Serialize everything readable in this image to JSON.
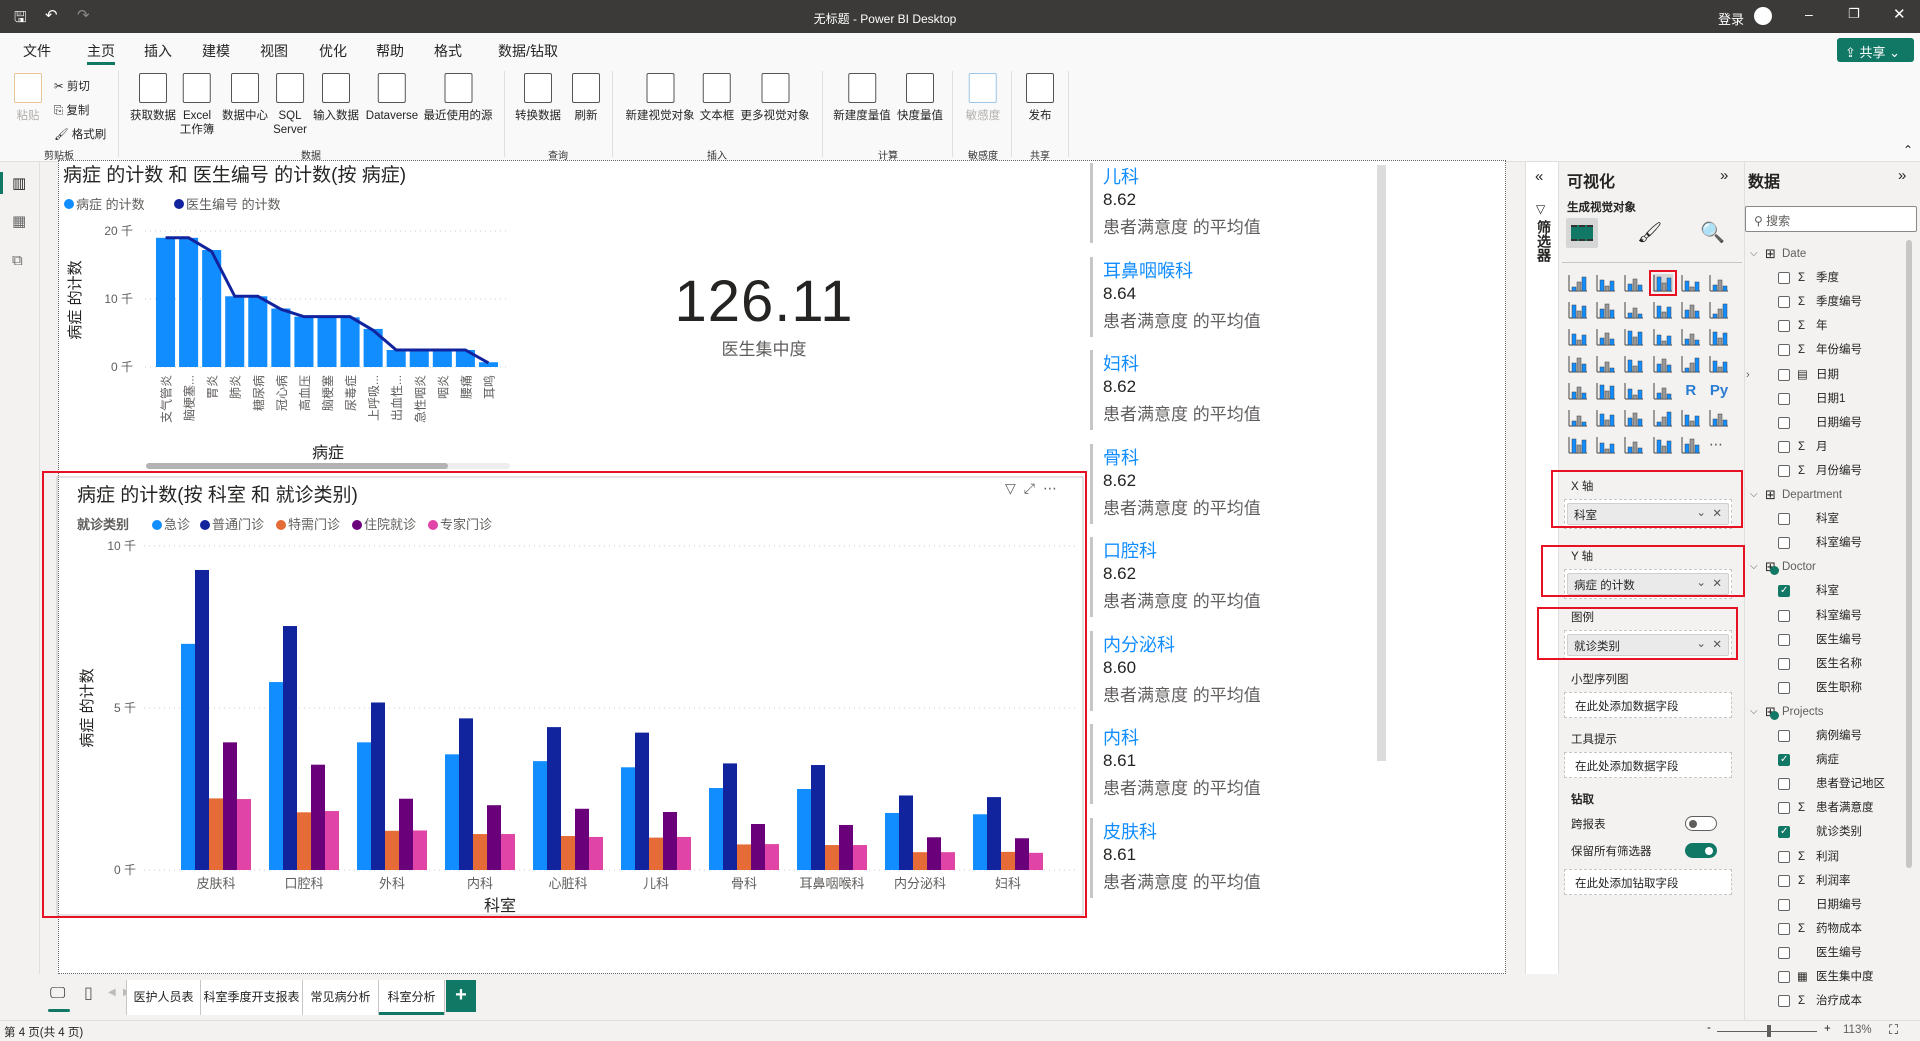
{
  "window": {
    "title": "无标题 - Power BI Desktop",
    "signin": "登录",
    "share_label": "共享"
  },
  "menu": {
    "items": [
      "文件",
      "主页",
      "插入",
      "建模",
      "视图",
      "优化",
      "帮助",
      "格式",
      "数据/钻取"
    ],
    "active": "主页"
  },
  "ribbon": {
    "clipboard": {
      "paste": "粘贴",
      "cut": "剪切",
      "copy": "复制",
      "format_painter": "格式刷"
    },
    "buttons": [
      "获取数据",
      "Excel\n工作簿",
      "数据中心",
      "SQL\nServer",
      "输入数据",
      "Dataverse",
      "最近使用的源",
      "转换数据",
      "刷新",
      "新建视觉对象",
      "文本框",
      "更多视觉对象",
      "新建度量值",
      "快度量值",
      "敏感度",
      "发布"
    ],
    "groups": [
      "剪贴板",
      "数据",
      "查询",
      "插入",
      "计算",
      "敏感度",
      "共享"
    ]
  },
  "colors": {
    "accent": "#117865",
    "series1": "#118DFF",
    "series2": "#12239E",
    "series3": "#E66C37",
    "series4": "#6B007B",
    "series5": "#E044A7",
    "highlight": "#E81123"
  },
  "chart_data": [
    {
      "type": "bar+line",
      "title": "病症 的计数 和 医生编号 的计数(按 病症)",
      "xlabel": "病症",
      "ylabel": "病症 的计数",
      "ylim": [
        0,
        20000
      ],
      "yticks": [
        "0 千",
        "10 千",
        "20 千"
      ],
      "grid": true,
      "legend": "top-left",
      "categories": [
        "支气管炎",
        "脑梗塞...",
        "胃炎",
        "肺炎",
        "糖尿病",
        "冠心病",
        "高血压",
        "脑梗塞",
        "尿毒症",
        "上呼吸...",
        "出血性...",
        "急性咽炎",
        "咽炎",
        "腰痛",
        "耳鸣"
      ],
      "series": [
        {
          "name": "病症 的计数",
          "kind": "bar",
          "values": [
            19000,
            19000,
            17200,
            10400,
            10400,
            8600,
            7400,
            7400,
            7300,
            5600,
            2500,
            2500,
            2500,
            2500,
            700
          ]
        },
        {
          "name": "医生编号 的计数",
          "kind": "line",
          "values": [
            19000,
            19000,
            17000,
            10400,
            10400,
            8500,
            7400,
            7400,
            7400,
            5400,
            2500,
            2500,
            2500,
            2500,
            600
          ]
        }
      ]
    },
    {
      "type": "bar",
      "title": "病症 的计数(按 科室 和 就诊类别)",
      "xlabel": "科室",
      "ylabel": "病症 的计数",
      "legend_title": "就诊类别",
      "ylim": [
        0,
        10000
      ],
      "yticks": [
        "0 千",
        "5 千",
        "10 千"
      ],
      "grid": true,
      "legend": "top-left",
      "categories": [
        "皮肤科",
        "口腔科",
        "外科",
        "内科",
        "心脏科",
        "儿科",
        "骨科",
        "耳鼻咽喉科",
        "内分泌科",
        "妇科"
      ],
      "series": [
        {
          "name": "急诊",
          "values": [
            6980,
            5800,
            3940,
            3570,
            3360,
            3170,
            2530,
            2500,
            1760,
            1720
          ]
        },
        {
          "name": "普通门诊",
          "values": [
            9260,
            7530,
            5170,
            4680,
            4410,
            4240,
            3290,
            3240,
            2300,
            2250
          ]
        },
        {
          "name": "特需门诊",
          "values": [
            2210,
            1780,
            1210,
            1110,
            1050,
            1000,
            790,
            770,
            550,
            560
          ]
        },
        {
          "name": "住院就诊",
          "values": [
            3940,
            3250,
            2200,
            2000,
            1890,
            1790,
            1420,
            1390,
            1010,
            980
          ]
        },
        {
          "name": "专家门诊",
          "values": [
            2190,
            1820,
            1220,
            1110,
            1020,
            1020,
            800,
            770,
            550,
            530
          ]
        }
      ]
    }
  ],
  "kpi": {
    "value": "126.11",
    "label": "医生集中度"
  },
  "cards": [
    {
      "dept": "儿科",
      "value": "8.62",
      "label": "患者满意度 的平均值"
    },
    {
      "dept": "耳鼻咽喉科",
      "value": "8.64",
      "label": "患者满意度 的平均值"
    },
    {
      "dept": "妇科",
      "value": "8.62",
      "label": "患者满意度 的平均值"
    },
    {
      "dept": "骨科",
      "value": "8.62",
      "label": "患者满意度 的平均值"
    },
    {
      "dept": "口腔科",
      "value": "8.62",
      "label": "患者满意度 的平均值"
    },
    {
      "dept": "内分泌科",
      "value": "8.60",
      "label": "患者满意度 的平均值"
    },
    {
      "dept": "内科",
      "value": "8.61",
      "label": "患者满意度 的平均值"
    },
    {
      "dept": "皮肤科",
      "value": "8.61",
      "label": "患者满意度 的平均值"
    }
  ],
  "filters": {
    "label": "筛选器"
  },
  "viz": {
    "title": "可视化",
    "subtitle": "生成视觉对象",
    "icons": [
      "stacked-bar-chart",
      "stacked-column-chart",
      "clustered-bar-chart",
      "clustered-column-chart",
      "100-stacked-bar-chart",
      "100-stacked-column-chart",
      "line-chart",
      "area-chart",
      "stacked-area-chart",
      "line-stacked-column-chart",
      "line-clustered-column-chart",
      "ribbon-chart",
      "waterfall-chart",
      "funnel-chart",
      "scatter-chart",
      "pie-chart",
      "donut-chart",
      "treemap",
      "map",
      "filled-map",
      "azure-map",
      "gauge",
      "card",
      "multi-row-card",
      "kpi",
      "slicer",
      "table",
      "matrix",
      "r-visual",
      "python-visual",
      "key-influencers",
      "decomposition-tree",
      "qa",
      "smart-narrative",
      "goals",
      "paginated-report",
      "power-apps",
      "power-automate",
      "arcgis-map",
      "power-apps-2",
      "power-automate-2",
      "more"
    ],
    "selected_icon": "clustered-column-chart",
    "wells": {
      "x_axis": {
        "label": "X 轴",
        "value": "科室"
      },
      "y_axis": {
        "label": "Y 轴",
        "value": "病症 的计数"
      },
      "legend": {
        "label": "图例",
        "value": "就诊类别"
      },
      "small_multiples": {
        "label": "小型序列图",
        "placeholder": "在此处添加数据字段"
      },
      "tooltips": {
        "label": "工具提示",
        "placeholder": "在此处添加数据字段"
      }
    },
    "drill": {
      "label": "钻取",
      "cross_report": "跨报表",
      "cross_report_on": false,
      "keep_filters": "保留所有筛选器",
      "keep_filters_on": true,
      "placeholder": "在此处添加钻取字段"
    }
  },
  "data_pane": {
    "title": "数据",
    "search_placeholder": "搜索",
    "tree": [
      {
        "t": "table",
        "label": "Date"
      },
      {
        "label": "季度",
        "sigma": true
      },
      {
        "label": "季度编号",
        "sigma": true
      },
      {
        "label": "年",
        "sigma": true
      },
      {
        "label": "年份编号",
        "sigma": true
      },
      {
        "label": "日期",
        "calendar": true,
        "expand": true
      },
      {
        "label": "日期1"
      },
      {
        "label": "日期编号"
      },
      {
        "label": "月",
        "sigma": true
      },
      {
        "label": "月份编号",
        "sigma": true
      },
      {
        "t": "table",
        "label": "Department"
      },
      {
        "label": "科室"
      },
      {
        "label": "科室编号"
      },
      {
        "t": "table",
        "label": "Doctor",
        "used": true
      },
      {
        "label": "科室",
        "checked": true
      },
      {
        "label": "科室编号"
      },
      {
        "label": "医生编号"
      },
      {
        "label": "医生名称"
      },
      {
        "label": "医生职称"
      },
      {
        "t": "table",
        "label": "Projects",
        "used": true
      },
      {
        "label": "病例编号"
      },
      {
        "label": "病症",
        "checked": true
      },
      {
        "label": "患者登记地区"
      },
      {
        "label": "患者满意度",
        "sigma": true
      },
      {
        "label": "就诊类别",
        "checked": true
      },
      {
        "label": "利润",
        "sigma": true
      },
      {
        "label": "利润率",
        "sigma": true
      },
      {
        "label": "日期编号"
      },
      {
        "label": "药物成本",
        "sigma": true
      },
      {
        "label": "医生编号"
      },
      {
        "label": "医生集中度",
        "measure": true
      },
      {
        "label": "治疗成本",
        "sigma": true
      }
    ]
  },
  "pages": {
    "tabs": [
      "医护人员表",
      "科室季度开支报表",
      "常见病分析",
      "科室分析"
    ],
    "active": "科室分析",
    "add": "+"
  },
  "status": {
    "page": "第 4 页(共 4 页)",
    "zoom": "113%",
    "zoom_level": 113
  }
}
